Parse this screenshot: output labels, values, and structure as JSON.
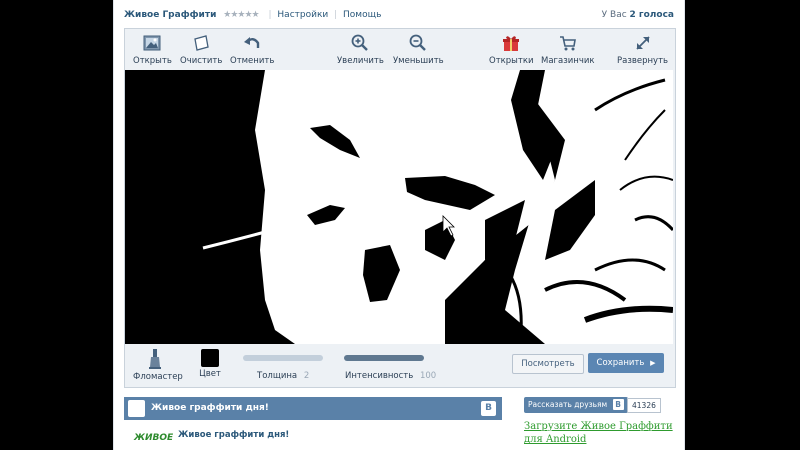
{
  "header": {
    "app_title": "Живое Граффити",
    "rating_stars": "★★★★★",
    "settings_link": "Настройки",
    "help_link": "Помощь",
    "votes_prefix": "У Вас",
    "votes_value": "2 голоса"
  },
  "toolbar": {
    "open_label": "Открыть",
    "clear_label": "Очистить",
    "undo_label": "Отменить",
    "zoom_in_label": "Увеличить",
    "zoom_out_label": "Уменьшить",
    "postcards_label": "Открытки",
    "shop_label": "Магазинчик",
    "expand_label": "Развернуть"
  },
  "bottom": {
    "marker_label": "Фломастер",
    "color_label": "Цвет",
    "color_value": "#000000",
    "thickness_label": "Толщина",
    "thickness_value": "2",
    "intensity_label": "Интенсивность",
    "intensity_value": "100",
    "preview_button": "Посмотреть",
    "save_button": "Сохранить"
  },
  "daily": {
    "header_title": "Живое граффити дня!",
    "logo_text": "ЖИВОЕ",
    "vk_badge": "В",
    "item_title": "Живое граффити дня!"
  },
  "side": {
    "share_label": "Рассказать друзьям",
    "vk_badge": "В",
    "share_count": "41326",
    "android_link": "Загрузите Живое Граффити для Android"
  },
  "colors": {
    "accent": "#5a81a8",
    "link": "#2b587a",
    "save_button": "#5b86b3",
    "promo_link": "#2e9b2e"
  }
}
